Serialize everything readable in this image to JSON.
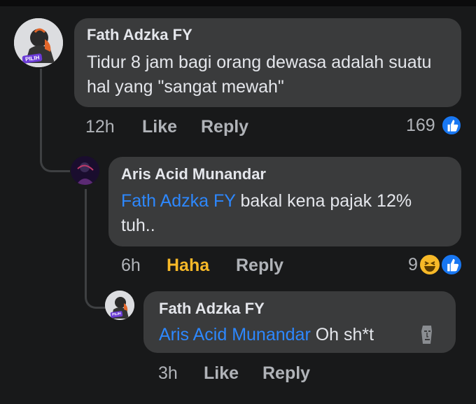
{
  "comments": [
    {
      "author": "Fath Adzka FY",
      "avatar_badge": "PILIH",
      "text": "Tidur 8 jam bagi orang dewasa adalah suatu hal yang \"sangat mewah\"",
      "time": "12h",
      "actions": [
        "Like",
        "Reply"
      ],
      "reaction_count": "169",
      "reaction_icons": [
        "like-icon"
      ]
    },
    {
      "author": "Aris Acid Munandar",
      "mention": "Fath Adzka FY",
      "text": "bakal kena pajak 12% tuh..",
      "time": "6h",
      "actions": [
        "Haha",
        "Reply"
      ],
      "reaction_count": "9",
      "reaction_icons": [
        "haha-icon",
        "like-icon"
      ]
    },
    {
      "author": "Fath Adzka FY",
      "avatar_badge": "PILIH",
      "mention": "Aris Acid Munandar",
      "text": "Oh sh*t",
      "emoji": "moai-icon",
      "time": "3h",
      "actions": [
        "Like",
        "Reply"
      ]
    }
  ],
  "colors": {
    "background": "#18191a",
    "bubble": "#3a3b3c",
    "mention": "#2d88ff",
    "haha_active": "#f7b928",
    "like_blue": "#1877f2"
  }
}
